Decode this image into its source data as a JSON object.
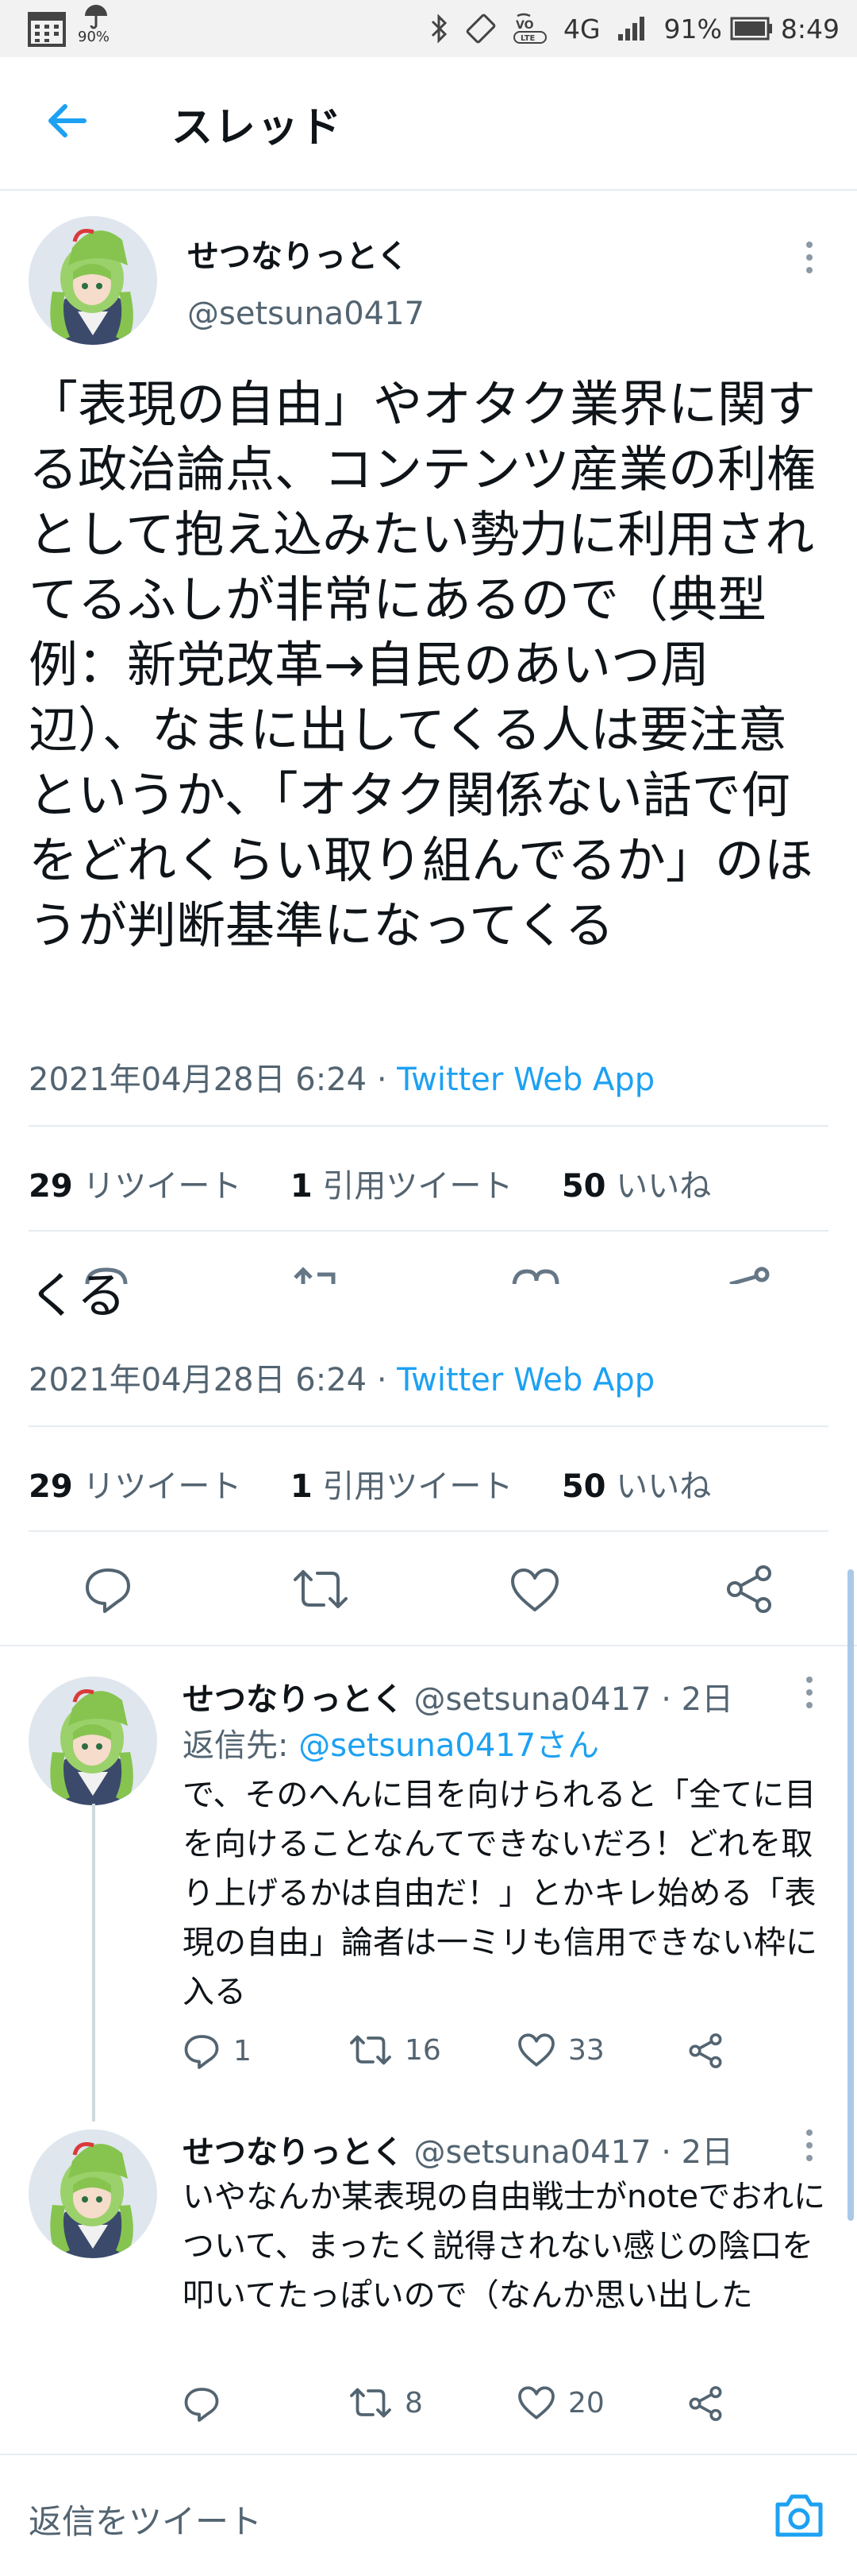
{
  "status_bar": {
    "battery_text": "91%",
    "time": "8:49",
    "weather_pct": "90%",
    "network_text": "4G",
    "volte_text": "VO LTE"
  },
  "header": {
    "title": "スレッド"
  },
  "tweet": {
    "author_name": "せつなりっとく",
    "author_handle": "@setsuna0417",
    "text": "「表現の自由」やオタク業界に関する政治論点、コンテンツ産業の利権として抱え込みたい勢力に利用されてるふしが非常にあるので（典型例：新党改革→自民のあいつ周辺）、なまに出してくる人は要注意というか、「オタク関係ない話で何をどれくらい取り組んでるか」のほうが判断基準になってくる",
    "text_tail": "くる",
    "timestamp": "2021年04月28日 6:24",
    "via": "Twitter Web App",
    "retweets": "29",
    "retweets_label": "リツイート",
    "quotes": "1",
    "quotes_label": "引用ツイート",
    "likes": "50",
    "likes_label": "いいね"
  },
  "replies": [
    {
      "name": "せつなりっとく",
      "handle": "@setsuna0417",
      "age": "· 2日",
      "reply_to_label": "返信先:",
      "reply_to_user": "@setsuna0417さん",
      "text": "で、そのへんに目を向けられると「全てに目を向けることなんてできないだろ！どれを取り上げるかは自由だ！」とかキレ始める「表現の自由」論者は一ミリも信用できない枠に入る",
      "reply_count": "1",
      "retweet_count": "16",
      "like_count": "33"
    },
    {
      "name": "せつなりっとく",
      "handle": "@setsuna0417",
      "age": "· 2日",
      "text": "いやなんか某表現の自由戦士がnoteでおれについて、まったく説得されない感じの陰口を叩いてたっぽいので（なんか思い出した",
      "reply_count": "",
      "retweet_count": "8",
      "like_count": "20"
    }
  ],
  "composer": {
    "placeholder": "返信をツイート"
  },
  "colors": {
    "accent": "#1da1f2",
    "text": "#0f1419",
    "muted": "#536471",
    "divider": "#e6ecf0"
  }
}
